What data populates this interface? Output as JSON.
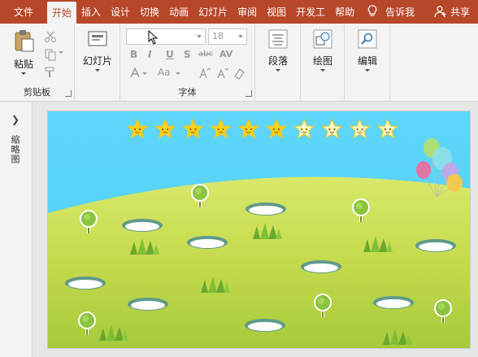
{
  "tabs": [
    {
      "label": "文件"
    },
    {
      "label": "开始",
      "active": true
    },
    {
      "label": "插入"
    },
    {
      "label": "设计"
    },
    {
      "label": "切换"
    },
    {
      "label": "动画"
    },
    {
      "label": "幻灯片"
    },
    {
      "label": "审阅"
    },
    {
      "label": "视图"
    },
    {
      "label": "开发工"
    },
    {
      "label": "帮助"
    }
  ],
  "tell_me": "告诉我",
  "share": "共享",
  "ribbon": {
    "clipboard": {
      "paste": "粘贴",
      "group": "剪贴板"
    },
    "slides": {
      "new_slide": "幻灯片"
    },
    "font": {
      "font_name": "",
      "font_size": "18",
      "group": "字体",
      "bold": "B",
      "italic": "I",
      "underline": "U",
      "shadow": "S",
      "strike": "abc",
      "spacing": "AV",
      "case": "Aa"
    },
    "paragraph": {
      "label": "段落"
    },
    "drawing": {
      "label": "绘图"
    },
    "editing": {
      "label": "编辑"
    }
  },
  "left_panel": {
    "label": "缩略图"
  },
  "slide": {
    "stars_total": 10,
    "stars_filled": 6
  },
  "colors": {
    "accent": "#b7472a",
    "sky": "#5bd2f6",
    "grass": "#c9de50",
    "star_filled": "#ffd21f",
    "star_empty": "#fbf6c6"
  }
}
